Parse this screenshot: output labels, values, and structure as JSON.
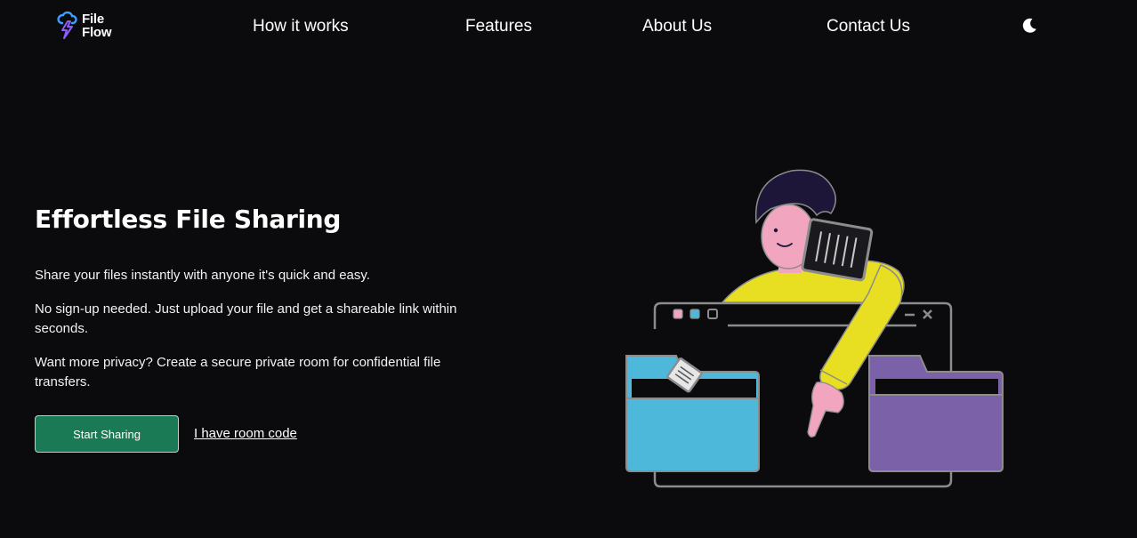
{
  "brand": {
    "name_line1": "File",
    "name_line2": "Flow",
    "accent": "#7c5cff",
    "accent_secondary": "#3aa0ff"
  },
  "nav": {
    "links": [
      {
        "label": "How it works"
      },
      {
        "label": "Features"
      },
      {
        "label": "About Us"
      },
      {
        "label": "Contact Us"
      }
    ],
    "theme_icon": "moon-icon"
  },
  "hero": {
    "title": "Effortless File Sharing",
    "paragraphs": [
      "Share your files instantly with anyone it's quick and easy.",
      "No sign-up needed. Just upload your file and get a shareable link within seconds.",
      "Want more privacy? Create a secure private room for confidential file transfers."
    ],
    "primary_button": "Start Sharing",
    "secondary_link": "I have room code"
  },
  "colors": {
    "background": "#0b0b0d",
    "button": "#1b7a56",
    "folder_left": "#4db8d9",
    "folder_right": "#7b62a8",
    "shirt": "#e8df22",
    "skin": "#f1a5bf",
    "hair": "#1d1638"
  }
}
